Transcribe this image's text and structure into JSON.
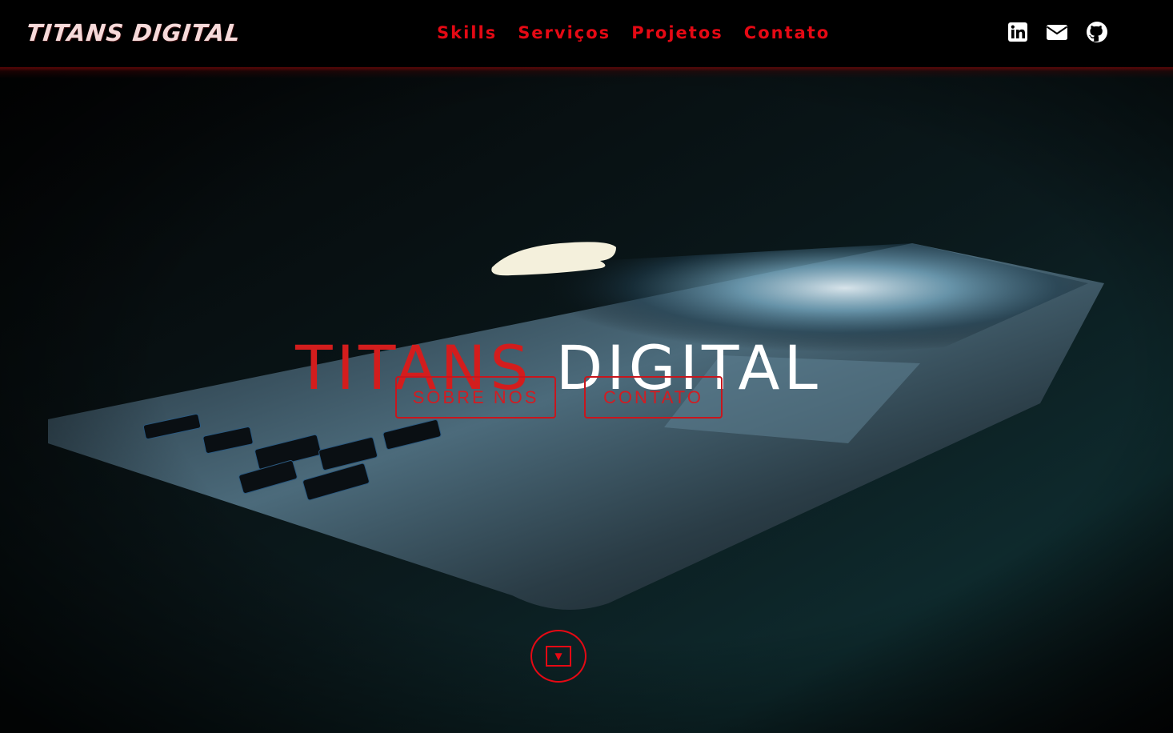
{
  "header": {
    "brand": "TITANS DIGITAL",
    "nav": [
      {
        "label": "Skills"
      },
      {
        "label": "Serviços"
      },
      {
        "label": "Projetos"
      },
      {
        "label": "Contato"
      }
    ],
    "social_icons": [
      "linkedin-icon",
      "envelope-icon",
      "github-icon"
    ]
  },
  "hero": {
    "title_part1": "TITANS",
    "title_part2": "DIGITAL",
    "buttons": {
      "about": "SOBRE NOS",
      "contact": "CONTATO"
    },
    "scroll_icon": "caret-down-square-icon",
    "scroll_glyph": "▼"
  },
  "colors": {
    "accent": "#e50914",
    "title_red": "#d31d1d",
    "header_bg": "#000000",
    "brand_text": "#f6dada"
  }
}
